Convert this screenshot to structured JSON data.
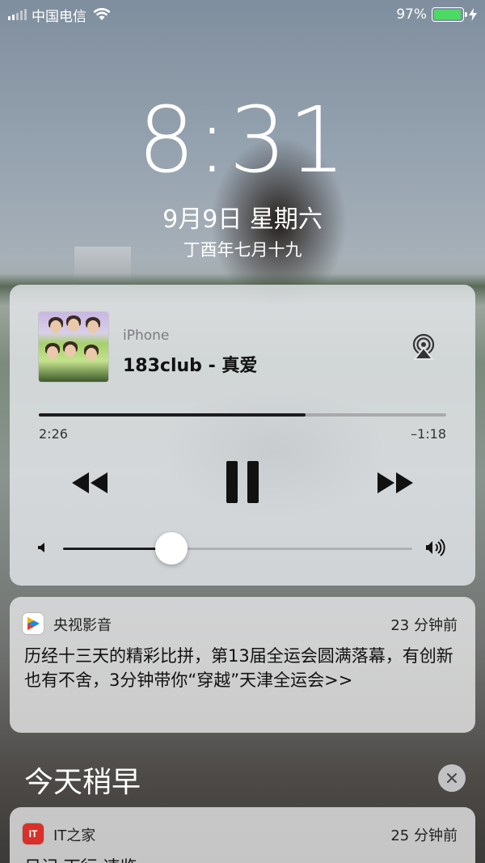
{
  "status_bar": {
    "carrier": "中国电信",
    "battery_text": "97%",
    "battery_level": 0.97,
    "battery_color": "#4cd964"
  },
  "lock_screen": {
    "time": "8:31",
    "date": "9月9日 星期六",
    "lunar_date": "丁酉年七月十九"
  },
  "now_playing": {
    "source": "iPhone",
    "track": "183club - 真爱",
    "elapsed": "2:26",
    "remaining": "–1:18",
    "progress": 0.655,
    "volume": 0.31,
    "icons": [
      "airplay-icon",
      "rewind-icon",
      "pause-icon",
      "fast-forward-icon",
      "volume-low-icon",
      "volume-high-icon"
    ]
  },
  "notifications": [
    {
      "app": "央视影音",
      "time": "23 分钟前",
      "body": "历经十三天的精彩比拼，第13届全运会圆满落幕，有创新也有不舍，3分钟带你“穿越”天津全运会>>"
    },
    {
      "app": "IT之家",
      "icon_text": "IT",
      "time": "25 分钟前",
      "body": "日记 下行 速览"
    }
  ],
  "section": {
    "title": "今天稍早"
  }
}
